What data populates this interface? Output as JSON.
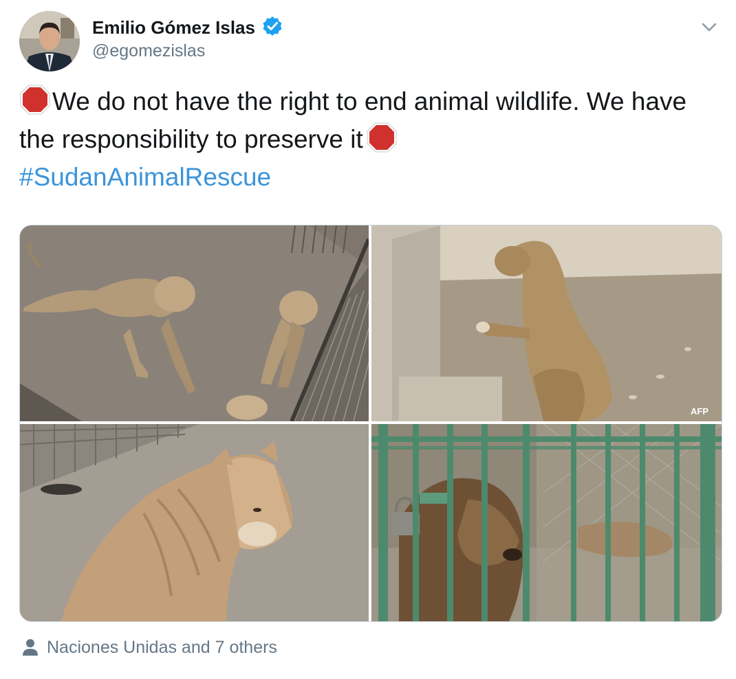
{
  "author": {
    "name": "Emilio Gómez Islas",
    "handle": "@egomezislas",
    "verified": true
  },
  "tweet": {
    "line1_text": "We do not have the right to end animal wildlife. We have the responsibility to preserve it",
    "hashtag": "#SudanAnimalRescue",
    "emoji_icon": "stop-sign-icon"
  },
  "media": {
    "photos": [
      {
        "label": "starving-lions-lying-on-floor"
      },
      {
        "label": "emaciated-lion-sitting"
      },
      {
        "label": "thin-lioness-closeup"
      },
      {
        "label": "lion-behind-cage-bars"
      }
    ],
    "watermark": "AFP"
  },
  "social_context": {
    "text": "Naciones Unidas and 7 others",
    "icon": "person-icon"
  },
  "colors": {
    "link": "#3b94d9",
    "muted": "#657786",
    "verified": "#1da1f2",
    "stop": "#d0312d"
  }
}
